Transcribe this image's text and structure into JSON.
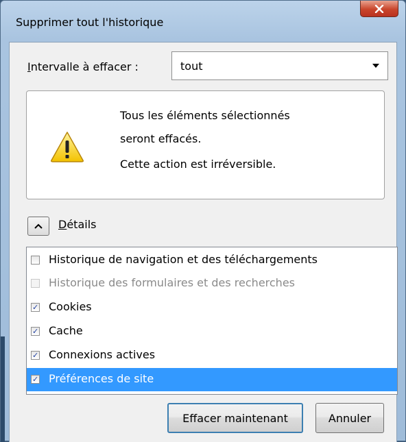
{
  "window": {
    "title": "Supprimer tout l'historique"
  },
  "range": {
    "label_prefix": "I",
    "label_rest": "ntervalle à effacer :",
    "selected": "tout"
  },
  "warning": {
    "line1": "Tous les éléments sélectionnés",
    "line2": "seront effacés.",
    "line3": "Cette action est irréversible.",
    "icon": "warning-icon"
  },
  "details": {
    "label_prefix": "D",
    "label_rest": "étails",
    "expanded": true
  },
  "items": [
    {
      "label": "Historique de navigation et des téléchargements",
      "checked": false,
      "disabled": false,
      "selected": false
    },
    {
      "label": "Historique des formulaires et des recherches",
      "checked": false,
      "disabled": true,
      "selected": false
    },
    {
      "label": "Cookies",
      "checked": true,
      "disabled": false,
      "selected": false
    },
    {
      "label": "Cache",
      "checked": true,
      "disabled": false,
      "selected": false
    },
    {
      "label": "Connexions actives",
      "checked": true,
      "disabled": false,
      "selected": false
    },
    {
      "label": "Préférences de site",
      "checked": true,
      "disabled": false,
      "selected": true
    }
  ],
  "buttons": {
    "clear_now": "Effacer maintenant",
    "cancel": "Annuler"
  },
  "colors": {
    "selection": "#3399ff",
    "close_button": "#c9452b"
  }
}
